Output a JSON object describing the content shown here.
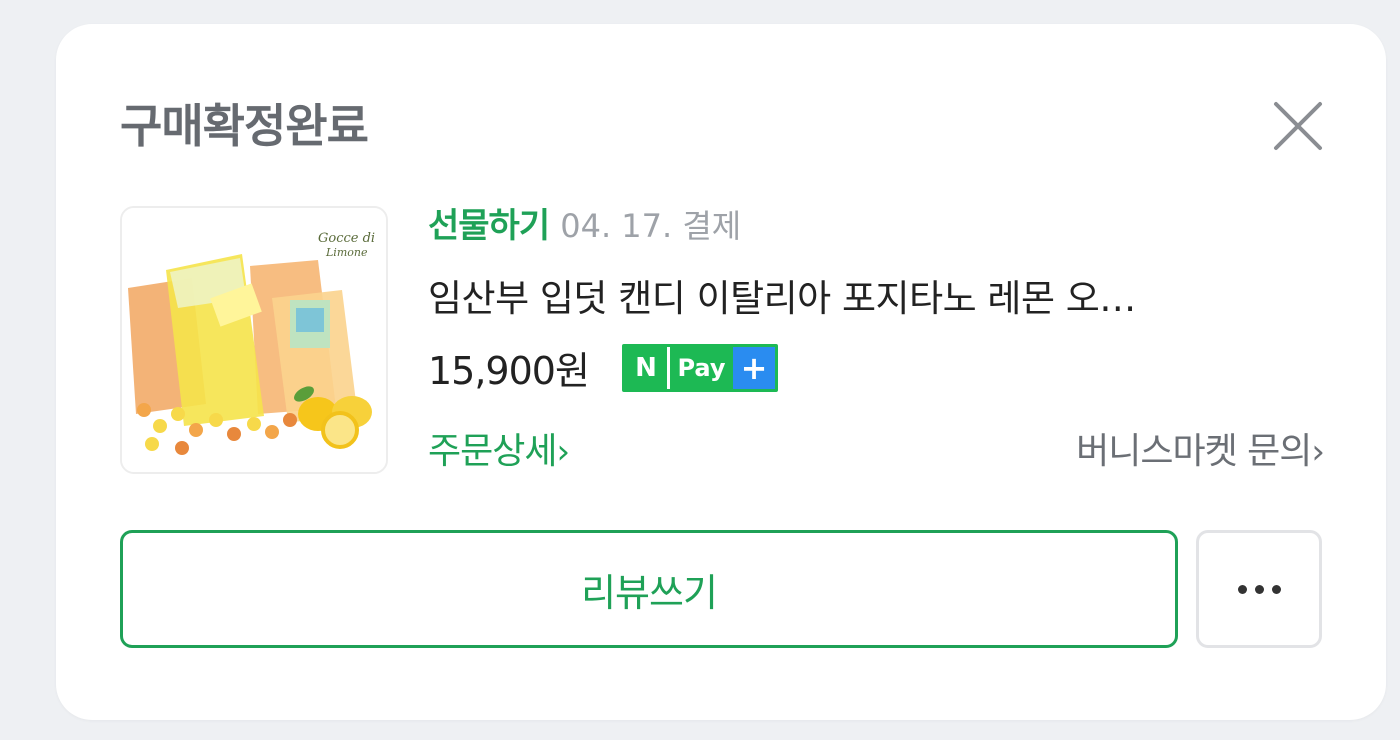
{
  "card": {
    "title": "구매확정완료",
    "close_icon": "close-icon"
  },
  "order": {
    "gift_label": "선물하기",
    "date": "04. 17. 결제",
    "product_name": "임산부 입덧 캔디 이탈리아 포지타노 레몬 오…",
    "price": "15,900원",
    "npay": {
      "n": "N",
      "pay": "Pay",
      "plus": "+"
    },
    "product_image_text": [
      "Gocce di",
      "Limone"
    ],
    "detail_link": "주문상세",
    "inquiry_link": "버니스마켓 문의"
  },
  "actions": {
    "review_label": "리뷰쓰기",
    "more_icon": "more-dots-icon"
  },
  "colors": {
    "accent_green": "#1fa157",
    "npay_green": "#1db954",
    "npay_blue": "#2a8cf0"
  }
}
